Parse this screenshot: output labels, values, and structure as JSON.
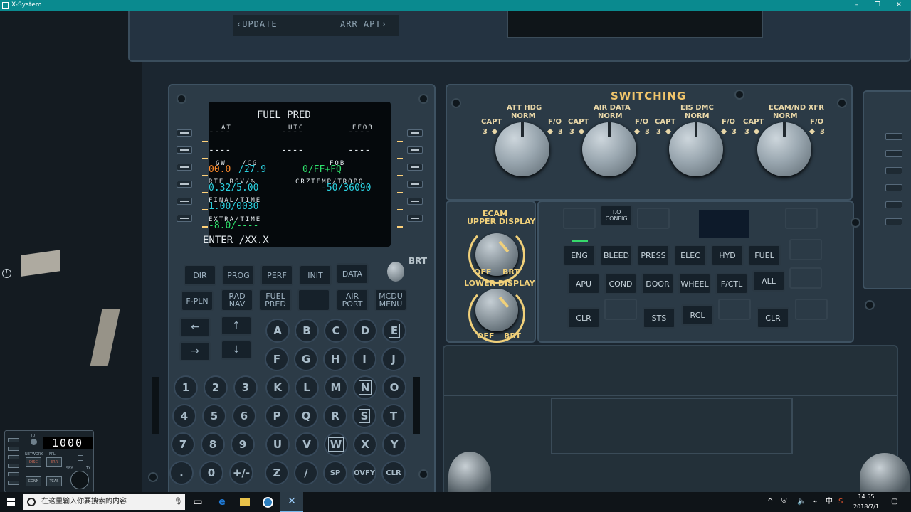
{
  "window": {
    "title": "X-System",
    "controls": [
      "–",
      "❐",
      "✕"
    ]
  },
  "overhead": {
    "update_label": "‹UPDATE",
    "arr_apt_label": "ARR APT›"
  },
  "mcdu": {
    "screen": {
      "title": "FUEL PRED",
      "col_headers": [
        "AT",
        "UTC",
        "EFOB"
      ],
      "row1": [
        "----",
        "----",
        "----"
      ],
      "row2": [
        "----",
        "----",
        "----"
      ],
      "gw_cg_label": "GW   /CG",
      "fob_label": "FOB",
      "gw_value": "00.0",
      "cg_value": "/27.9",
      "fob_value": "0/FF+FQ",
      "rte_rsv_label": "RTE RSV/%",
      "crz_label": "CRZTEMP/TROPO",
      "rte_rsv_value": "0.32/5.00",
      "crz_value": "-50/36090",
      "final_label": "FINAL/TIME",
      "final_value": "1.00/0030",
      "extra_label": "EXTRA/TIME",
      "extra_value": "-8.0/----",
      "scratchpad": "ENTER /XX.X"
    },
    "brt_label": "BRT",
    "func_keys_row1": [
      "DIR",
      "PROG",
      "PERF",
      "INIT",
      "DATA"
    ],
    "func_keys_row2": [
      "F-PLN",
      "RAD\nNAV",
      "FUEL\nPRED",
      "",
      "AIR\nPORT",
      "MCDU\nMENU"
    ],
    "arrow_keys": [
      "←",
      "↑",
      "→",
      "↓"
    ],
    "alpha_rows": [
      [
        "A",
        "B",
        "C",
        "D",
        "E"
      ],
      [
        "F",
        "G",
        "H",
        "I",
        "J"
      ],
      [
        "K",
        "L",
        "M",
        "N",
        "O"
      ],
      [
        "P",
        "Q",
        "R",
        "S",
        "T"
      ],
      [
        "U",
        "V",
        "W",
        "X",
        "Y"
      ],
      [
        "Z",
        "/",
        "SP",
        "OVFY",
        "CLR"
      ]
    ],
    "num_rows": [
      [
        "1",
        "2",
        "3"
      ],
      [
        "4",
        "5",
        "6"
      ],
      [
        "7",
        "8",
        "9"
      ],
      [
        ".",
        "0",
        "+/-"
      ]
    ]
  },
  "switching": {
    "title": "SWITCHING",
    "knobs": [
      {
        "label": "ATT HDG",
        "left": "CAPT",
        "center": "NORM",
        "right": "F/O",
        "n": "3"
      },
      {
        "label": "AIR DATA",
        "left": "CAPT",
        "center": "NORM",
        "right": "F/O",
        "n": "3"
      },
      {
        "label": "EIS DMC",
        "left": "CAPT",
        "center": "NORM",
        "right": "F/O",
        "n": "3"
      },
      {
        "label": "ECAM/ND XFR",
        "left": "CAPT",
        "center": "NORM",
        "right": "F/O",
        "n": "3"
      }
    ]
  },
  "ecam": {
    "title": "ECAM",
    "upper": "UPPER DISPLAY",
    "lower": "LOWER DISPLAY",
    "off": "OFF",
    "brt": "BRT"
  },
  "ecp": {
    "to_config": "T.O\nCONFIG",
    "row1": [
      "ENG",
      "BLEED",
      "PRESS",
      "ELEC",
      "HYD",
      "FUEL"
    ],
    "row2": [
      "APU",
      "COND",
      "DOOR",
      "WHEEL",
      "F/CTL",
      "ALL"
    ],
    "row3": [
      "CLR",
      "STS",
      "RCL",
      "CLR"
    ]
  },
  "transponder": {
    "code": "1000",
    "labels": {
      "network": "NETWORK",
      "fpl": "FPL",
      "sby": "SBY",
      "tx": "TX",
      "ident": "ID"
    },
    "buttons": [
      "DISC",
      "ERR",
      "CONN",
      "TCAS"
    ]
  },
  "taskbar": {
    "search_placeholder": "在这里输入你要搜索的内容",
    "clock_time": "14:55",
    "clock_date": "2018/7/1",
    "ime": "中",
    "colors": {
      "edge": "#1f7ad6",
      "explorer": "#e8c24a",
      "xsystem": "#2c7fbf"
    }
  }
}
